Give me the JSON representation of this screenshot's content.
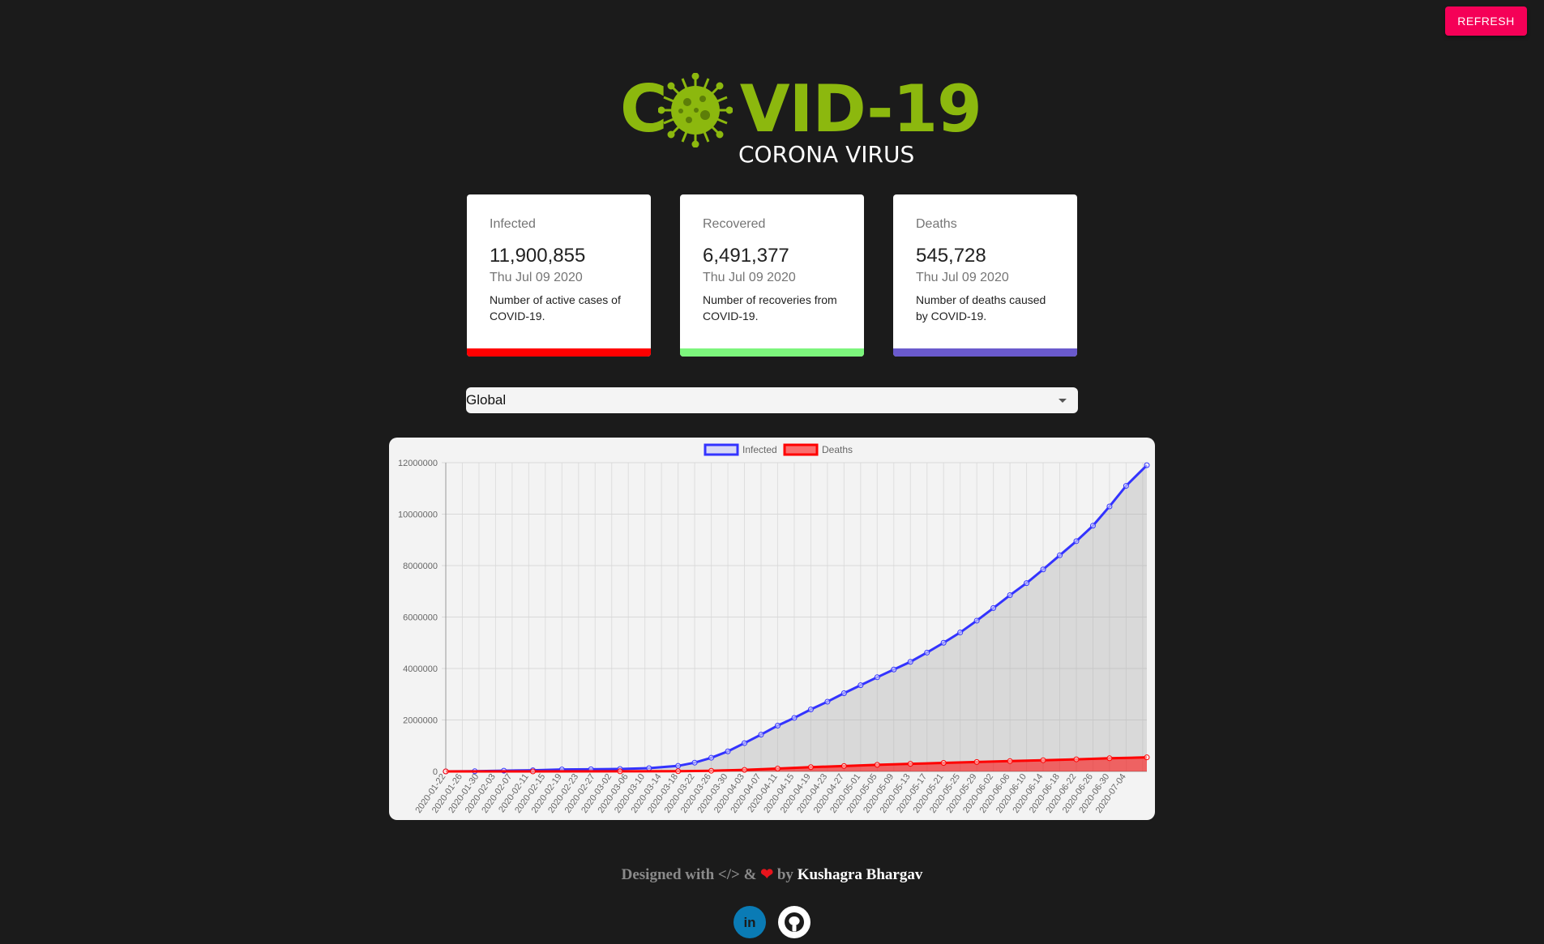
{
  "header": {
    "refresh_label": "REFRESH"
  },
  "logo": {
    "title_pre": "C",
    "title_post": "VID-19",
    "subtitle": "CORONA VIRUS",
    "icon": "virus-icon"
  },
  "cards": [
    {
      "title": "Infected",
      "value": "11,900,855",
      "date": "Thu Jul 09 2020",
      "description": "Number of active cases of COVID-19.",
      "color": "#ff0000"
    },
    {
      "title": "Recovered",
      "value": "6,491,377",
      "date": "Thu Jul 09 2020",
      "description": "Number of recoveries from COVID-19.",
      "color": "#7cf57c"
    },
    {
      "title": "Deaths",
      "value": "545,728",
      "date": "Thu Jul 09 2020",
      "description": "Number of deaths caused by COVID-19.",
      "color": "#6a5acd"
    }
  ],
  "country_select": {
    "value": "Global"
  },
  "chart_data": {
    "type": "line",
    "legend_position": "top",
    "grid": true,
    "ylim": [
      0,
      12000000
    ],
    "yticks": [
      "0",
      "2000000",
      "4000000",
      "6000000",
      "8000000",
      "10000000",
      "12000000"
    ],
    "x_start": "2020-01-22",
    "x_end": "2020-07-09",
    "xtick_labels": [
      "2020-01-22",
      "2020-01-26",
      "2020-01-30",
      "2020-02-03",
      "2020-02-07",
      "2020-02-11",
      "2020-02-15",
      "2020-02-19",
      "2020-02-23",
      "2020-02-27",
      "2020-03-02",
      "2020-03-06",
      "2020-03-10",
      "2020-03-14",
      "2020-03-18",
      "2020-03-22",
      "2020-03-26",
      "2020-03-30",
      "2020-04-03",
      "2020-04-07",
      "2020-04-11",
      "2020-04-15",
      "2020-04-19",
      "2020-04-23",
      "2020-04-27",
      "2020-05-01",
      "2020-05-05",
      "2020-05-09",
      "2020-05-13",
      "2020-05-17",
      "2020-05-21",
      "2020-05-25",
      "2020-05-29",
      "2020-06-02",
      "2020-06-06",
      "2020-06-10",
      "2020-06-14",
      "2020-06-18",
      "2020-06-22",
      "2020-06-26",
      "2020-06-30",
      "2020-07-04"
    ],
    "series": [
      {
        "name": "Infected",
        "color": "#3333ff",
        "x": [
          "2020-01-22",
          "2020-01-29",
          "2020-02-05",
          "2020-02-12",
          "2020-02-19",
          "2020-02-26",
          "2020-03-04",
          "2020-03-11",
          "2020-03-18",
          "2020-03-22",
          "2020-03-26",
          "2020-03-30",
          "2020-04-03",
          "2020-04-07",
          "2020-04-11",
          "2020-04-15",
          "2020-04-19",
          "2020-04-23",
          "2020-04-27",
          "2020-05-01",
          "2020-05-05",
          "2020-05-09",
          "2020-05-13",
          "2020-05-17",
          "2020-05-21",
          "2020-05-25",
          "2020-05-29",
          "2020-06-02",
          "2020-06-06",
          "2020-06-10",
          "2020-06-14",
          "2020-06-18",
          "2020-06-22",
          "2020-06-26",
          "2020-06-30",
          "2020-07-04",
          "2020-07-09"
        ],
        "values": [
          555,
          6000,
          28000,
          45000,
          75000,
          82000,
          95000,
          127000,
          215000,
          340000,
          530000,
          780000,
          1100000,
          1430000,
          1780000,
          2080000,
          2410000,
          2710000,
          3040000,
          3350000,
          3660000,
          3960000,
          4260000,
          4620000,
          5000000,
          5400000,
          5860000,
          6350000,
          6850000,
          7320000,
          7850000,
          8400000,
          8950000,
          9550000,
          10300000,
          11100000,
          11900855
        ]
      },
      {
        "name": "Deaths",
        "color": "#ff0000",
        "x": [
          "2020-01-22",
          "2020-02-12",
          "2020-03-04",
          "2020-03-18",
          "2020-03-26",
          "2020-04-03",
          "2020-04-11",
          "2020-04-19",
          "2020-04-27",
          "2020-05-05",
          "2020-05-13",
          "2020-05-21",
          "2020-05-29",
          "2020-06-06",
          "2020-06-14",
          "2020-06-22",
          "2020-06-30",
          "2020-07-09"
        ],
        "values": [
          17,
          1100,
          3300,
          9000,
          25000,
          60000,
          110000,
          165000,
          210000,
          255000,
          295000,
          330000,
          365000,
          400000,
          435000,
          470000,
          510000,
          545728
        ]
      }
    ]
  },
  "footer": {
    "designed_with": "Designed with </> & ",
    "heart": "❤",
    "by": " by ",
    "author": "Kushagra Bhargav"
  },
  "social": {
    "linkedin_icon": "linkedin-icon",
    "github_icon": "github-icon"
  }
}
